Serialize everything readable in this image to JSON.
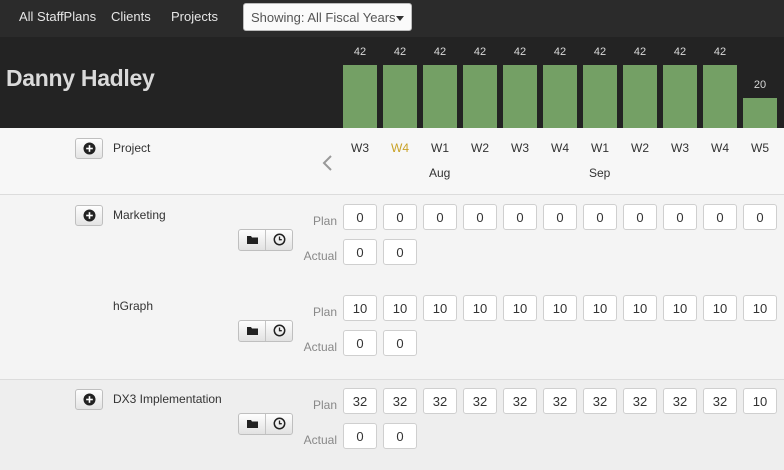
{
  "nav": {
    "all_staffplans": "All StaffPlans",
    "clients": "Clients",
    "projects": "Projects",
    "fiscal_select": "Showing: All Fiscal Years"
  },
  "user": {
    "name": "Danny Hadley"
  },
  "colors": {
    "bar": "#74a065",
    "current_week": "#c9a227",
    "header_bg": "#232323"
  },
  "workload": [
    42,
    42,
    42,
    42,
    42,
    42,
    42,
    42,
    42,
    42,
    20
  ],
  "weeks": {
    "header_label": "Project",
    "labels": [
      "W3",
      "W4",
      "W1",
      "W2",
      "W3",
      "W4",
      "W1",
      "W2",
      "W3",
      "W4",
      "W5"
    ],
    "current_index": 1,
    "months": [
      {
        "name": "Aug",
        "col": 2
      },
      {
        "name": "Sep",
        "col": 6
      }
    ]
  },
  "labels": {
    "plan": "Plan",
    "actual": "Actual"
  },
  "icons": {
    "add": "plus-circle-icon",
    "folder": "folder-icon",
    "clock": "clock-icon",
    "prev": "chevron-left-icon"
  },
  "clients": [
    {
      "name": "Marketing",
      "projects": [
        {
          "name": "",
          "plan": [
            "0",
            "0",
            "0",
            "0",
            "0",
            "0",
            "0",
            "0",
            "0",
            "0",
            "0"
          ],
          "actual": [
            "0",
            "0"
          ]
        },
        {
          "name": "hGraph",
          "plan": [
            "10",
            "10",
            "10",
            "10",
            "10",
            "10",
            "10",
            "10",
            "10",
            "10",
            "10"
          ],
          "actual": [
            "0",
            "0"
          ]
        }
      ]
    },
    {
      "name": "DX3 Implementation",
      "projects": [
        {
          "name": "",
          "plan": [
            "32",
            "32",
            "32",
            "32",
            "32",
            "32",
            "32",
            "32",
            "32",
            "32",
            "10"
          ],
          "actual": [
            "0",
            "0"
          ]
        }
      ]
    }
  ]
}
